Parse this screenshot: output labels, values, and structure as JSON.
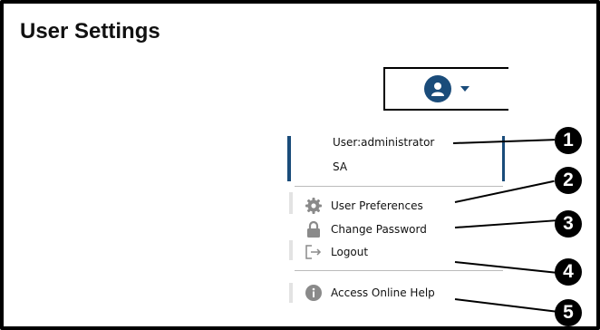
{
  "page": {
    "title": "User Settings"
  },
  "user_menu": {
    "button_icon": "user-avatar-icon",
    "user_line": "User:administrator",
    "role_line": "SA",
    "items": [
      {
        "label": "User Preferences",
        "icon": "gear-icon"
      },
      {
        "label": "Change Password",
        "icon": "lock-icon"
      },
      {
        "label": "Logout",
        "icon": "logout-icon"
      },
      {
        "label": "Access Online Help",
        "icon": "info-icon"
      }
    ]
  },
  "callouts": [
    "1",
    "2",
    "3",
    "4",
    "5"
  ],
  "colors": {
    "accent": "#1a4c7a",
    "icon_gray": "#8a8a8a",
    "callout": "#000000"
  }
}
